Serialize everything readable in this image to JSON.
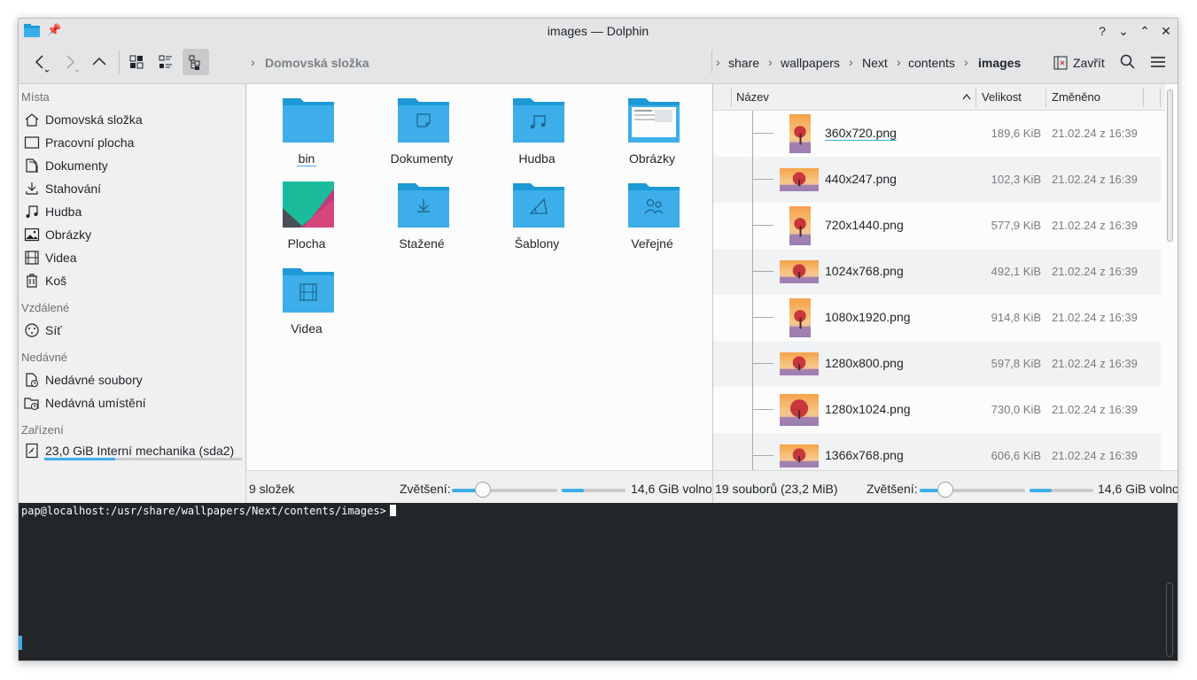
{
  "window": {
    "title": "images — Dolphin",
    "controls": [
      "?",
      "⌄",
      "⌃",
      "✕"
    ]
  },
  "toolbar": {
    "left_breadcrumb": "Domovská složka",
    "right_breadcrumb": [
      "share",
      "wallpapers",
      "Next",
      "contents",
      "images"
    ],
    "close_label": "Zavřít"
  },
  "sidebar": {
    "sections": [
      {
        "title": "Místa",
        "items": [
          {
            "label": "Domovská složka",
            "icon": "home-icon"
          },
          {
            "label": "Pracovní plocha",
            "icon": "desktop-icon"
          },
          {
            "label": "Dokumenty",
            "icon": "documents-icon"
          },
          {
            "label": "Stahování",
            "icon": "download-icon"
          },
          {
            "label": "Hudba",
            "icon": "music-icon"
          },
          {
            "label": "Obrázky",
            "icon": "pictures-icon"
          },
          {
            "label": "Videa",
            "icon": "video-icon"
          },
          {
            "label": "Koš",
            "icon": "trash-icon"
          }
        ]
      },
      {
        "title": "Vzdálené",
        "items": [
          {
            "label": "Síť",
            "icon": "network-icon"
          }
        ]
      },
      {
        "title": "Nedávné",
        "items": [
          {
            "label": "Nedávné soubory",
            "icon": "recent-files-icon"
          },
          {
            "label": "Nedávná umístění",
            "icon": "recent-locations-icon"
          }
        ]
      },
      {
        "title": "Zařízení",
        "items": [
          {
            "label": "23,0 GiB Interní mechanika (sda2)",
            "icon": "drive-icon",
            "usage_fraction": 0.36
          }
        ]
      }
    ]
  },
  "left_pane": {
    "folders": [
      {
        "label": "bin",
        "icon": "folder-icon"
      },
      {
        "label": "Dokumenty",
        "icon": "folder-documents-icon"
      },
      {
        "label": "Hudba",
        "icon": "folder-music-icon"
      },
      {
        "label": "Obrázky",
        "icon": "folder-pictures-icon"
      },
      {
        "label": "Plocha",
        "icon": "desktop-thumbnail-icon"
      },
      {
        "label": "Stažené",
        "icon": "folder-download-icon"
      },
      {
        "label": "Šablony",
        "icon": "folder-templates-icon"
      },
      {
        "label": "Veřejné",
        "icon": "folder-public-icon"
      },
      {
        "label": "Videa",
        "icon": "folder-videos-icon"
      }
    ],
    "status": {
      "count": "9 složek",
      "zoom_label": "Zvětšení:",
      "zoom_fraction": 0.29,
      "space_fraction": 0.35,
      "free": "14,6 GiB volno"
    }
  },
  "right_pane": {
    "columns": [
      "Název",
      "Velikost",
      "Změněno"
    ],
    "files": [
      {
        "name": "360x720.png",
        "size": "189,6 KiB",
        "date": "21.02.24 z 16:39",
        "orientation": "portrait"
      },
      {
        "name": "440x247.png",
        "size": "102,3 KiB",
        "date": "21.02.24 z 16:39",
        "orientation": "landscape"
      },
      {
        "name": "720x1440.png",
        "size": "577,9 KiB",
        "date": "21.02.24 z 16:39",
        "orientation": "portrait"
      },
      {
        "name": "1024x768.png",
        "size": "492,1 KiB",
        "date": "21.02.24 z 16:39",
        "orientation": "landscape"
      },
      {
        "name": "1080x1920.png",
        "size": "914,8 KiB",
        "date": "21.02.24 z 16:39",
        "orientation": "portrait"
      },
      {
        "name": "1280x800.png",
        "size": "597,8 KiB",
        "date": "21.02.24 z 16:39",
        "orientation": "landscape"
      },
      {
        "name": "1280x1024.png",
        "size": "730,0 KiB",
        "date": "21.02.24 z 16:39",
        "orientation": "square"
      },
      {
        "name": "1366x768.png",
        "size": "606,6 KiB",
        "date": "21.02.24 z 16:39",
        "orientation": "landscape"
      }
    ],
    "status": {
      "count": "19 souborů (23,2 MiB)",
      "zoom_label": "Zvětšení:",
      "zoom_fraction": 0.24,
      "space_fraction": 0.35,
      "free": "14,6 GiB volno"
    }
  },
  "terminal": {
    "prompt": "pap@localhost:/usr/share/wallpapers/Next/contents/images>"
  },
  "colors": {
    "accent": "#3daee9",
    "folder": "#3daee9",
    "folder_dark": "#1d99d6",
    "terminal_bg": "#232629"
  }
}
